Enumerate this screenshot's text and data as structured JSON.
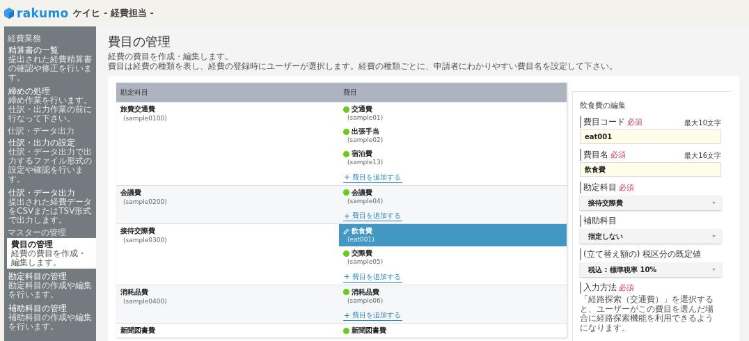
{
  "header": {
    "brand": "rakumo",
    "title": "ケイヒ - 経費担当 -"
  },
  "sidebar": {
    "sections": [
      {
        "heading": "経費業務",
        "items": [
          {
            "label": "精算書の一覧",
            "description": "提出された経費精算書の確認や修正を行います。",
            "selected": false
          },
          {
            "label": "締めの処理",
            "description": "締め作業を行います。仕訳・出力作業の前に行なって下さい。",
            "selected": false
          }
        ]
      },
      {
        "heading": "仕訳・データ出力",
        "items": [
          {
            "label": "仕訳・出力の設定",
            "description": "仕訳・データ出力で出力するファイル形式の設定や確認を行います。",
            "selected": false
          },
          {
            "label": "仕訳・データ出力",
            "description": "提出された経費データをCSVまたはTSV形式で出力します。",
            "selected": false
          }
        ]
      },
      {
        "heading": "マスターの管理",
        "items": [
          {
            "label": "費目の管理",
            "description": "経費の費目を作成・編集します。",
            "selected": true
          },
          {
            "label": "勘定科目の管理",
            "description": "勘定科目の作成や編集を行います。",
            "selected": false
          },
          {
            "label": "補助科目の管理",
            "description": "補助科目の作成や編集を行います。",
            "selected": false
          }
        ]
      }
    ]
  },
  "page": {
    "title": "費目の管理",
    "description": [
      "経費の費目を作成・編集します。",
      "費目は経費の種類を表し、経費の登録時にユーザーが選択します。経費の種類ごとに、申請者にわかりやすい費目名を設定して下さい。"
    ]
  },
  "table": {
    "columns": [
      "勘定科目",
      "費目"
    ],
    "rows": [
      {
        "account": "旅費交通費",
        "code": "(sample0100)",
        "items": [
          {
            "name": "交通費",
            "code": "(sample01)",
            "selected": false,
            "color": "#6cc91a"
          },
          {
            "name": "出張手当",
            "code": "(sample02)",
            "selected": false,
            "color": "#6cc91a"
          },
          {
            "name": "宿泊費",
            "code": "(sample13)",
            "selected": false,
            "color": "#6cc91a"
          }
        ],
        "add_link": "費目を追加する"
      },
      {
        "account": "会議費",
        "code": "(sample0200)",
        "items": [
          {
            "name": "会議費",
            "code": "(sample04)",
            "selected": false,
            "color": "#6cc91a"
          }
        ],
        "add_link": "費目を追加する"
      },
      {
        "account": "接待交際費",
        "code": "(sample0300)",
        "items": [
          {
            "name": "飲食費",
            "code": "(eat001)",
            "selected": true
          },
          {
            "name": "交際費",
            "code": "(sample05)",
            "selected": false,
            "color": "#6cc91a"
          }
        ],
        "add_link": "費目を追加する"
      },
      {
        "account": "消耗品費",
        "code": "(sample0400)",
        "items": [
          {
            "name": "消耗品費",
            "code": "(sample06)",
            "selected": false,
            "color": "#6cc91a"
          }
        ],
        "add_link": "費目を追加する"
      },
      {
        "account": "新聞図書費",
        "items": [
          {
            "name": "新聞図書費",
            "selected": false,
            "color": "#6cc91a"
          }
        ]
      }
    ]
  },
  "editor": {
    "title": "飲食費の編集",
    "fields": [
      {
        "kind": "text",
        "label": "費目コード",
        "required_tag": "必須",
        "hint": "最大10文字",
        "value": "eat001"
      },
      {
        "kind": "text",
        "label": "費目名",
        "required_tag": "必須",
        "hint": "最大16文字",
        "value": "飲食費"
      },
      {
        "kind": "select",
        "label": "勘定科目",
        "required_tag": "必須",
        "value": "接待交際費"
      },
      {
        "kind": "select",
        "label": "補助科目",
        "value": "指定しない"
      },
      {
        "kind": "select",
        "label": "(立て替え額の) 税区分の既定値",
        "value": "税込 : 標準税率 10%"
      },
      {
        "kind": "note",
        "label": "入力方法",
        "required_tag": "必須",
        "description": "「経路探索（交通費）」を選択すると、ユーザーがこの費目を選んだ場合に経路探索機能を利用できるようになります。"
      }
    ]
  }
}
